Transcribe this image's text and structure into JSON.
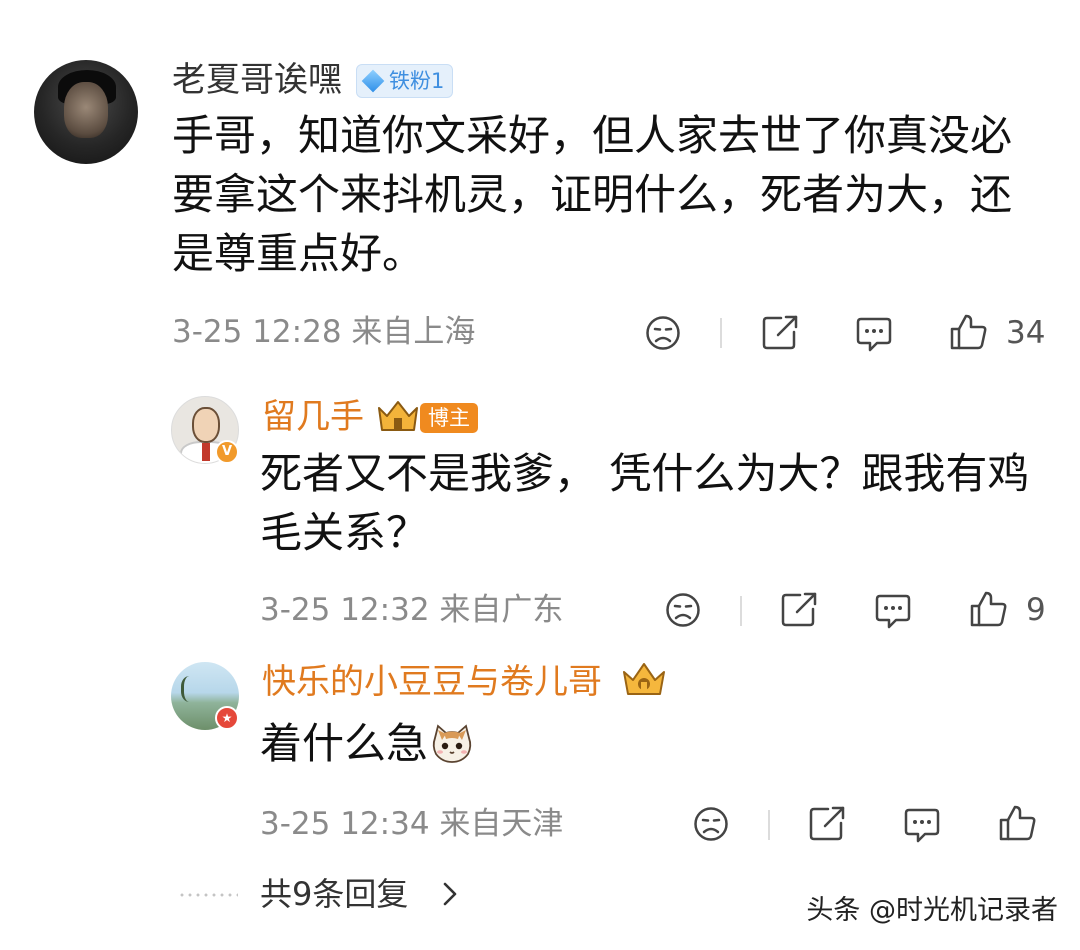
{
  "comment": {
    "author": "老夏哥诶嘿",
    "fan_badge": "铁粉1",
    "text": "手哥，知道你文采好，但人家去世了你真没必要拿这个来抖机灵，证明什么，死者为大，还是尊重点好。",
    "date": "3-25 12:28",
    "location": "来自上海",
    "likes": "34"
  },
  "replies": [
    {
      "author": "留几手",
      "author_badge": "博主",
      "verified_badge": "V",
      "text": "死者又不是我爹， 凭什么为大？跟我有鸡毛关系？",
      "date": "3-25 12:32",
      "location": "来自广东",
      "likes": "9"
    },
    {
      "author": "快乐的小豆豆与卷儿哥",
      "text": "着什么急",
      "date": "3-25 12:34",
      "location": "来自天津",
      "likes": ""
    }
  ],
  "more_replies": "共9条回复",
  "watermark": "头条 @时光机记录者",
  "colors": {
    "accent_orange": "#e07a1f",
    "fan_blue": "#3f8fe0",
    "meta_gray": "#8a8a8a"
  },
  "icons": [
    "dislike-face-icon",
    "share-icon",
    "comment-icon",
    "thumbs-up-icon",
    "crown-icon",
    "cat-emoji-icon",
    "chevron-right-icon"
  ]
}
